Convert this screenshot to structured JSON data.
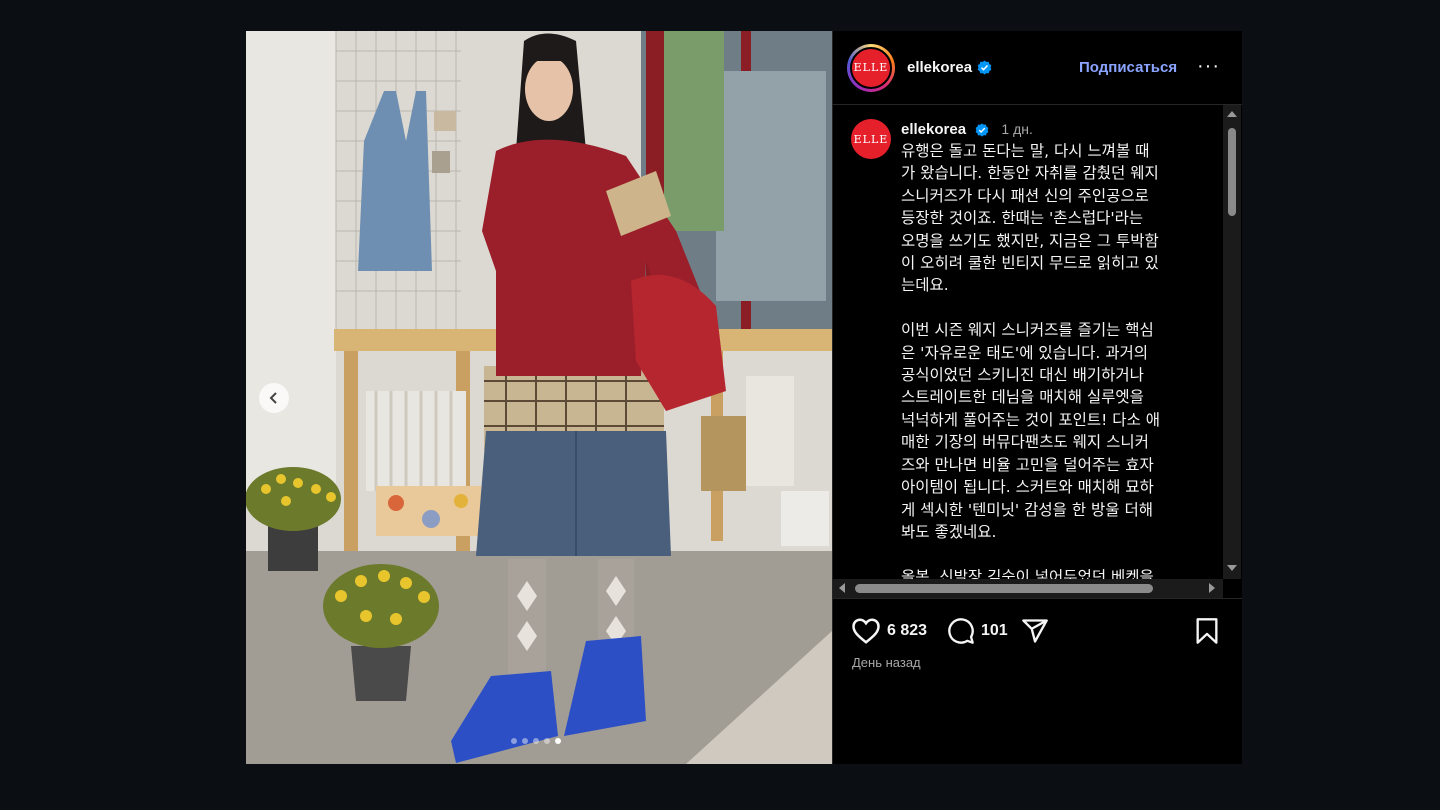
{
  "post": {
    "username": "ellekorea",
    "follow_label": "Подписаться",
    "more_label": "···",
    "avatar_text": "ELLE",
    "caption_time": "1 дн.",
    "caption": "유행은 돌고 돈다는 말, 다시 느껴볼 때\n가 왔습니다. 한동안 자취를 감췄던 웨지\n스니커즈가 다시 패션 신의 주인공으로\n등장한 것이죠. 한때는 '촌스럽다'라는\n오명을 쓰기도 했지만, 지금은 그 투박함\n이 오히려 쿨한 빈티지 무드로 읽히고 있\n는데요.\n\n이번 시즌 웨지 스니커즈를 즐기는 핵심\n은 '자유로운 태도'에 있습니다. 과거의\n공식이었던 스키니진 대신 배기하거나\n스트레이트한 데님을 매치해 실루엣을\n넉넉하게 풀어주는 것이 포인트! 다소 애\n매한 기장의 버뮤다팬츠도 웨지 스니커\n즈와 만나면 비율 고민을 덜어주는 효자\n아이템이 됩니다. 스커트와 매치해 묘하\n게 섹시한 '텐미닛' 감성을 한 방울 더해\n봐도 좋겠네요.\n\n올봄, 신발장 깊숙이 넣어두었던 베켓을",
    "likes": "6 823",
    "comments_count": "101",
    "time_ago": "День назад",
    "carousel_slides": 5,
    "carousel_active": 5
  },
  "colors": {
    "background": "#0b0f14",
    "panel": "#000000",
    "follow": "#8aa4ff",
    "verified": "#0095f6",
    "brand_red": "#e5202a"
  },
  "icons": [
    "chevron-left-icon",
    "verified-icon",
    "more-icon",
    "heart-icon",
    "comment-icon",
    "share-icon",
    "bookmark-icon"
  ]
}
